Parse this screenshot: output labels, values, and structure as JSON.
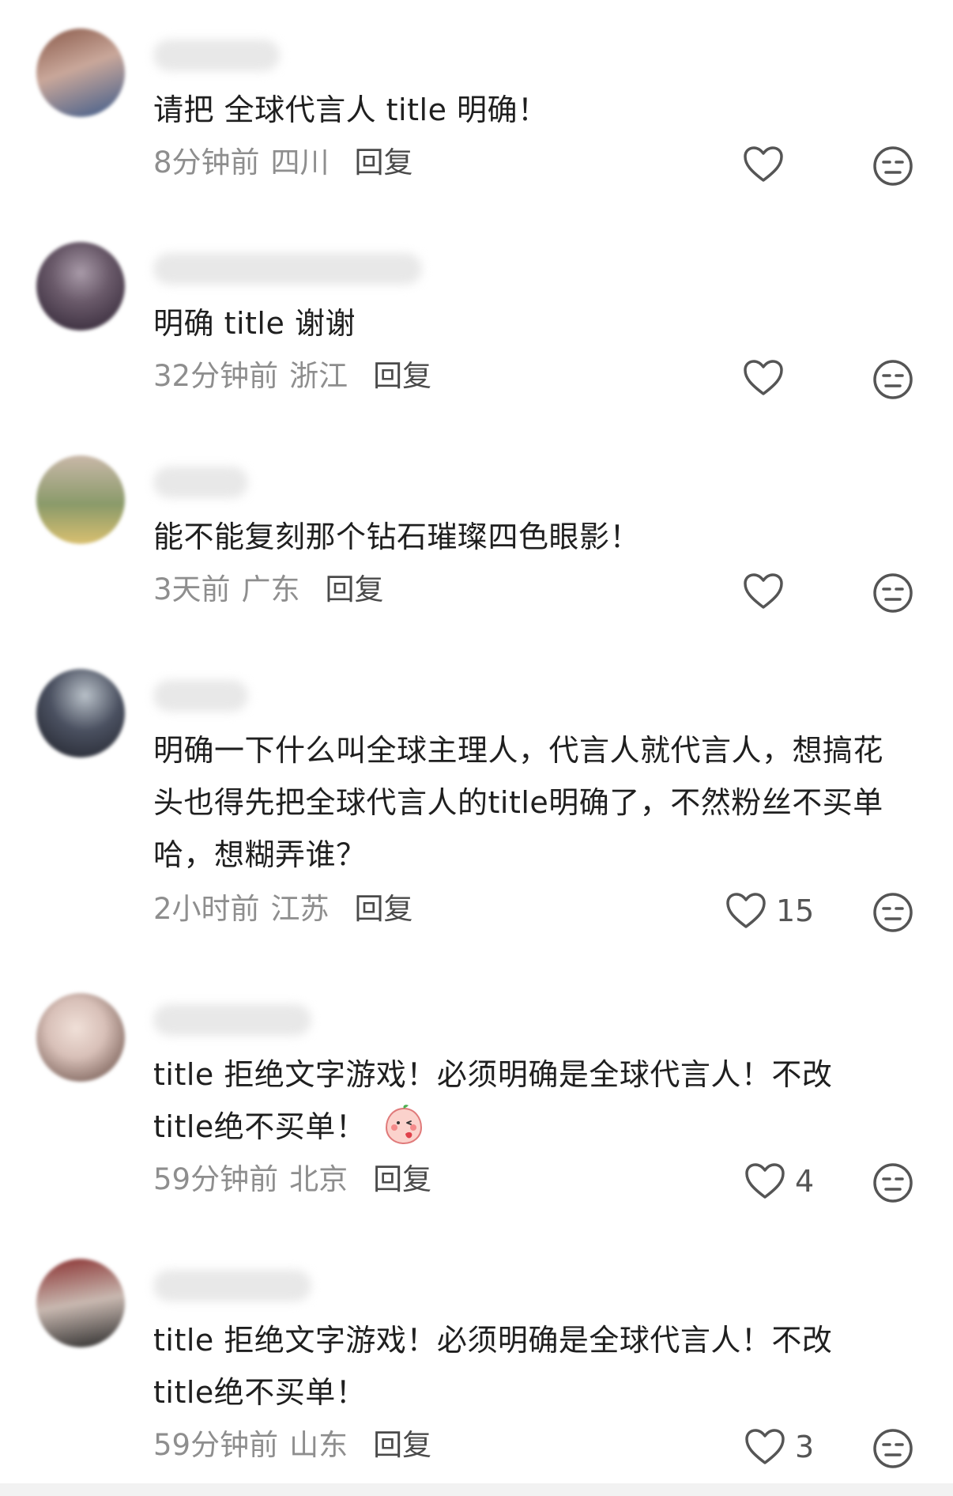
{
  "comments": [
    {
      "text": "请把 全球代言人 title 明确！",
      "time": "8分钟前",
      "location": "四川",
      "reply_label": "回复",
      "likes": "",
      "avatar_colors": [
        "#8a5a4a",
        "#c9a79a",
        "#3c5a8a"
      ]
    },
    {
      "text": "明确 title 谢谢",
      "time": "32分钟前",
      "location": "浙江",
      "reply_label": "回复",
      "likes": "",
      "avatar_colors": [
        "#2b2030",
        "#6a5a6a",
        "#a89aa8"
      ]
    },
    {
      "text": "能不能复刻那个钻石璀璨四色眼影！",
      "time": "3天前",
      "location": "广东",
      "reply_label": "回复",
      "likes": "",
      "avatar_colors": [
        "#d9c070",
        "#c9b8a8",
        "#8a9a6a"
      ]
    },
    {
      "text": "明确一下什么叫全球主理人，代言人就代言人，想搞花头也得先把全球代言人的title明确了，不然粉丝不买单哈，想糊弄谁？",
      "time": "2小时前",
      "location": "江苏",
      "reply_label": "回复",
      "likes": "15",
      "avatar_colors": [
        "#1e2028",
        "#4a5060",
        "#b8c0c8"
      ]
    },
    {
      "text": "title 拒绝文字游戏！必须明确是全球代言人！不改title绝不买单！",
      "time": "59分钟前",
      "location": "北京",
      "reply_label": "回复",
      "likes": "4",
      "avatar_colors": [
        "#d8c0b8",
        "#5a4038",
        "#f0e0d8"
      ],
      "emoji": "blushing-peach-emoji"
    },
    {
      "text": "title 拒绝文字游戏！必须明确是全球代言人！不改title绝不买单！",
      "time": "59分钟前",
      "location": "山东",
      "reply_label": "回复",
      "likes": "3",
      "avatar_colors": [
        "#8a3030",
        "#c8b8b0",
        "#2a2a2a"
      ]
    }
  ],
  "colors": {
    "text": "#1f1f1f",
    "meta": "#8e8e8e",
    "reply": "#4a4a4a",
    "icon": "#555555"
  }
}
